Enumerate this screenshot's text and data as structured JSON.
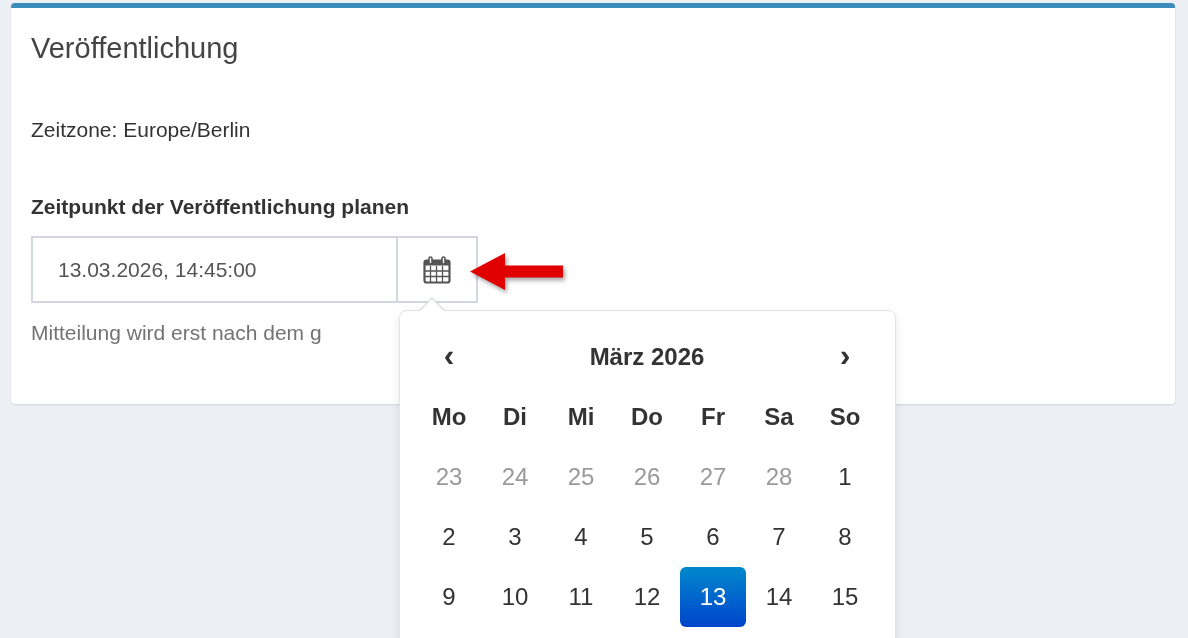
{
  "panel": {
    "title": "Veröffentlichung",
    "timezone": "Zeitzone: Europe/Berlin"
  },
  "schedule": {
    "label": "Zeitpunkt der Veröffentlichung planen",
    "value": "13.03.2026, 14:45:00",
    "help": "Mitteilung wird erst nach dem g"
  },
  "datepicker": {
    "prev": "‹",
    "month": "März 2026",
    "next": "›",
    "weekdays": [
      "Mo",
      "Di",
      "Mi",
      "Do",
      "Fr",
      "Sa",
      "So"
    ],
    "weeks": [
      [
        {
          "day": "23",
          "other_month": true,
          "selected": false
        },
        {
          "day": "24",
          "other_month": true,
          "selected": false
        },
        {
          "day": "25",
          "other_month": true,
          "selected": false
        },
        {
          "day": "26",
          "other_month": true,
          "selected": false
        },
        {
          "day": "27",
          "other_month": true,
          "selected": false
        },
        {
          "day": "28",
          "other_month": true,
          "selected": false
        },
        {
          "day": "1",
          "other_month": false,
          "selected": false
        }
      ],
      [
        {
          "day": "2",
          "other_month": false,
          "selected": false
        },
        {
          "day": "3",
          "other_month": false,
          "selected": false
        },
        {
          "day": "4",
          "other_month": false,
          "selected": false
        },
        {
          "day": "5",
          "other_month": false,
          "selected": false
        },
        {
          "day": "6",
          "other_month": false,
          "selected": false
        },
        {
          "day": "7",
          "other_month": false,
          "selected": false
        },
        {
          "day": "8",
          "other_month": false,
          "selected": false
        }
      ],
      [
        {
          "day": "9",
          "other_month": false,
          "selected": false
        },
        {
          "day": "10",
          "other_month": false,
          "selected": false
        },
        {
          "day": "11",
          "other_month": false,
          "selected": false
        },
        {
          "day": "12",
          "other_month": false,
          "selected": false
        },
        {
          "day": "13",
          "other_month": false,
          "selected": true
        },
        {
          "day": "14",
          "other_month": false,
          "selected": false
        },
        {
          "day": "15",
          "other_month": false,
          "selected": false
        }
      ]
    ]
  }
}
